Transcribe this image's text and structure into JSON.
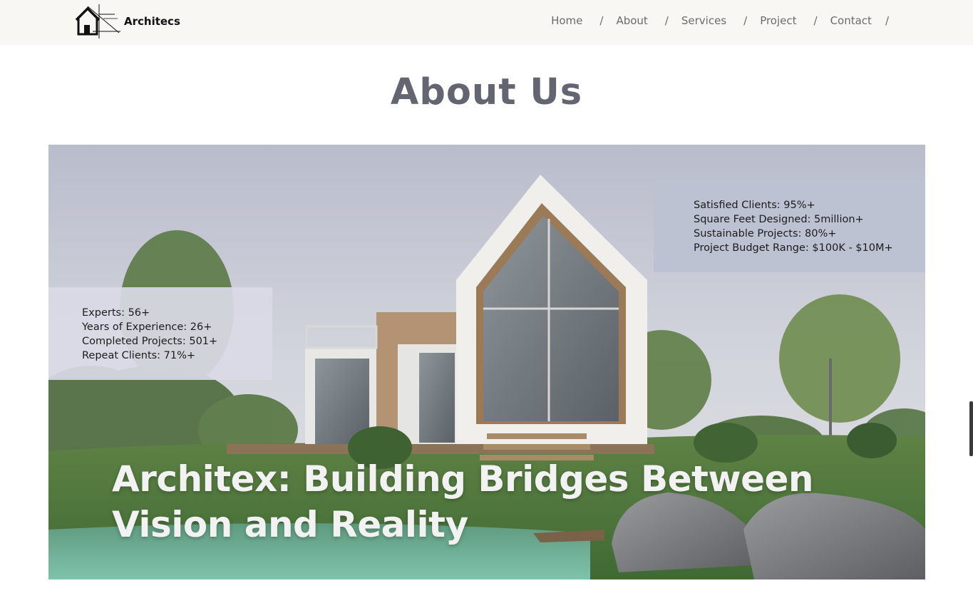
{
  "header": {
    "logo_text": "Architecs",
    "nav": [
      {
        "label": "Home"
      },
      {
        "label": "About"
      },
      {
        "label": "Services"
      },
      {
        "label": "Project"
      },
      {
        "label": "Contact"
      }
    ],
    "separator": "/"
  },
  "main": {
    "title": "About Us",
    "hero": {
      "image": "modern-gabled-house-by-pond",
      "heading_line1": "Architex: Building Bridges Between",
      "heading_line2": "Vision and Reality",
      "stats_left": [
        "Experts: 56+",
        "Years of Experience: 26+",
        "Completed Projects: 501+",
        "Repeat Clients: 71%+"
      ],
      "stats_right": [
        "Satisfied Clients: 95%+",
        "Square Feet Designed: 5million+",
        "Sustainable Projects: 80%+",
        "Project Budget Range: $100K - $10M+"
      ]
    }
  },
  "colors": {
    "navbar_bg": "#f8f7f3",
    "title": "#636571",
    "nav_text": "#6b6b6b"
  }
}
